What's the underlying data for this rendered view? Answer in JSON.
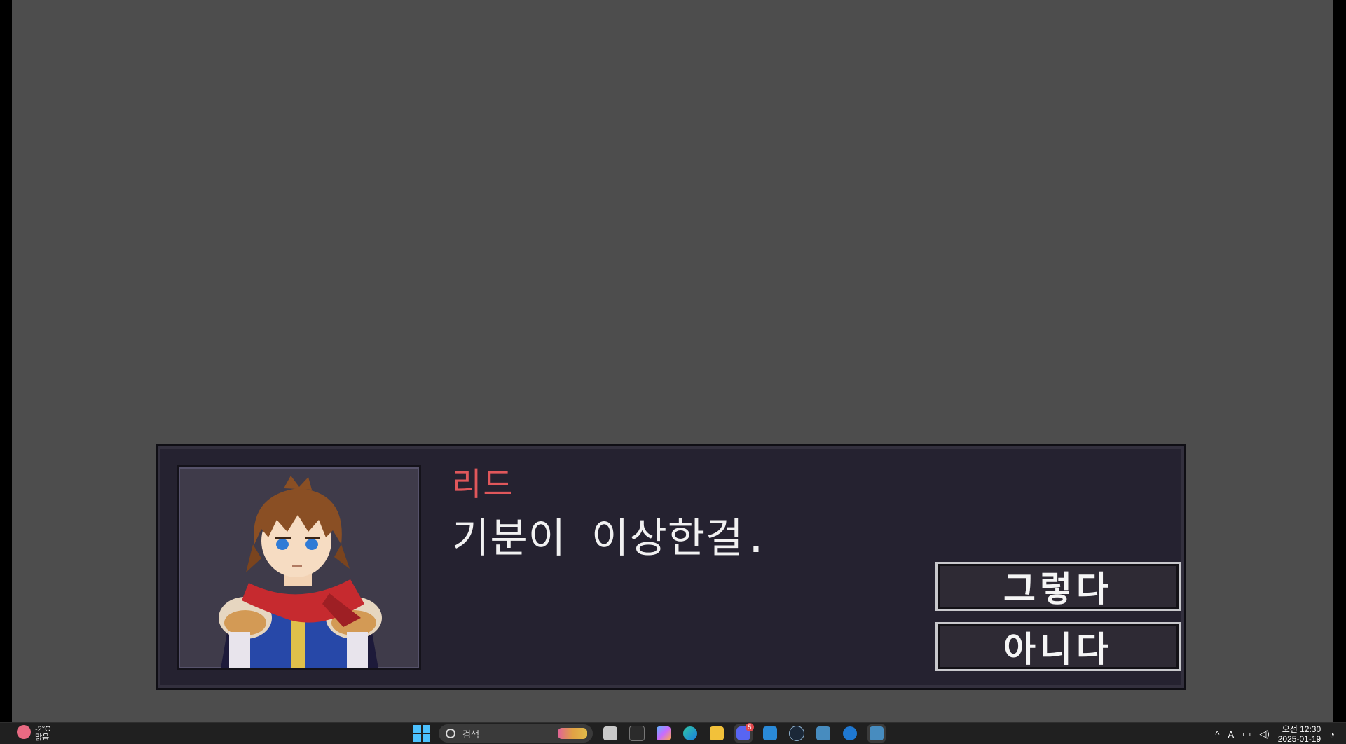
{
  "dialog": {
    "speaker_name": "리드",
    "text": "기분이 이상한걸.",
    "choices": [
      {
        "label": "그렇다"
      },
      {
        "label": "아니다"
      }
    ],
    "speaker_color": "#e0575b"
  },
  "taskbar": {
    "weather": {
      "temp": "-2°C",
      "condition": "맑음"
    },
    "search_placeholder": "검색",
    "apps": [
      {
        "icon": "file-explorer-icon"
      },
      {
        "icon": "terminal-icon"
      },
      {
        "icon": "copilot-icon"
      },
      {
        "icon": "edge-browser-icon"
      },
      {
        "icon": "folder-icon"
      },
      {
        "icon": "discord-icon",
        "badge": "5"
      },
      {
        "icon": "vscode-icon"
      },
      {
        "icon": "steam-icon"
      },
      {
        "icon": "godot-icon"
      },
      {
        "icon": "blue-app-icon"
      },
      {
        "icon": "godot-game-icon"
      }
    ],
    "tray": {
      "ime": "A",
      "clock_time": "오전 12:30",
      "clock_date": "2025-01-19"
    }
  }
}
